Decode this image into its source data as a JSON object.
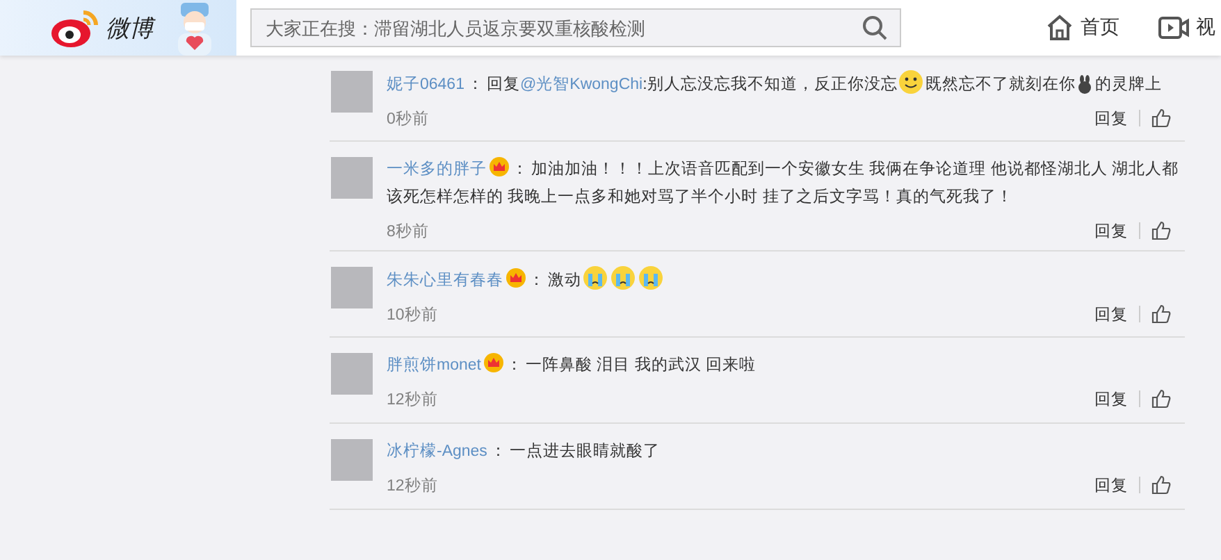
{
  "header": {
    "logo_text": "微博",
    "search": {
      "placeholder": "大家正在搜：滞留湖北人员返京要双重核酸检测"
    },
    "nav": [
      {
        "label": "首页",
        "kind": "home"
      },
      {
        "label": "视",
        "kind": "video"
      }
    ]
  },
  "comments": [
    {
      "user": "妮子06461",
      "vip": false,
      "separator": "：",
      "parts": [
        {
          "kind": "text",
          "text": "回复"
        },
        {
          "kind": "link",
          "text": "@光智KwongChi"
        },
        {
          "kind": "text",
          "text": ":别人忘没忘我不知道，反正你没忘"
        },
        {
          "kind": "smile-emoji"
        },
        {
          "kind": "text",
          "text": "既然忘不了就刻在你"
        },
        {
          "kind": "rabbit-emoji"
        },
        {
          "kind": "text",
          "text": "的灵牌上"
        }
      ],
      "time": "0秒前",
      "reply": "回复"
    },
    {
      "user": "一米多的胖子",
      "vip": true,
      "separator": "：",
      "parts": [
        {
          "kind": "text",
          "text": "加油加油！！！上次语音匹配到一个安徽女生 我俩在争论道理 他说都怪湖北人 湖北人都该死怎样怎样的 我晚上一点多和她对骂了半个小时 挂了之后文字骂！真的气死我了！"
        }
      ],
      "time": "8秒前",
      "reply": "回复"
    },
    {
      "user": "朱朱心里有春春",
      "vip": true,
      "separator": "：",
      "parts": [
        {
          "kind": "text",
          "text": "激动"
        },
        {
          "kind": "cry-emoji"
        },
        {
          "kind": "cry-emoji"
        },
        {
          "kind": "cry-emoji"
        }
      ],
      "time": "10秒前",
      "reply": "回复"
    },
    {
      "user": "胖煎饼monet",
      "vip": true,
      "separator": "：",
      "parts": [
        {
          "kind": "text",
          "text": "一阵鼻酸 泪目 我的武汉 回来啦"
        }
      ],
      "time": "12秒前",
      "reply": "回复"
    },
    {
      "user": "冰柠檬-Agnes",
      "vip": false,
      "separator": "：",
      "parts": [
        {
          "kind": "text",
          "text": "一点进去眼睛就酸了"
        }
      ],
      "time": "12秒前",
      "reply": "回复"
    }
  ]
}
